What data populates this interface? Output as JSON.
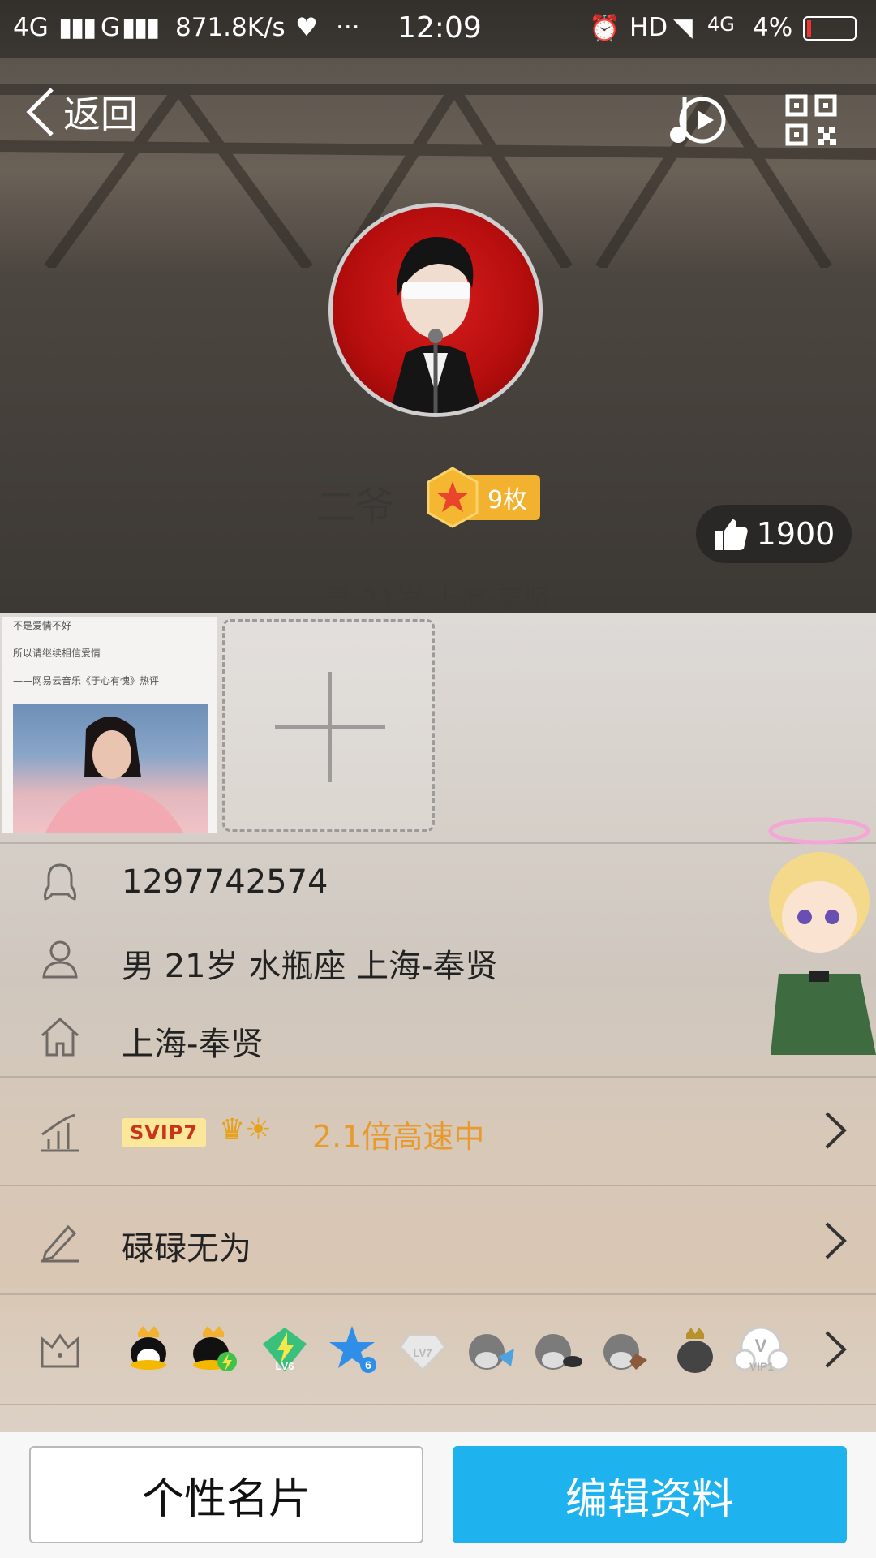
{
  "status_bar": {
    "network1": "4G",
    "network2": "G",
    "speed": "871.8K/s",
    "more": "···",
    "time": "12:09",
    "hd": "HD",
    "net3": "4G",
    "battery": "4%"
  },
  "header": {
    "back_label": "返回",
    "music_icon": "music-play-icon",
    "qr_icon": "qr-code-icon"
  },
  "profile": {
    "name": "二爷",
    "medal_count": "9枚",
    "likes": "1900",
    "subline": "男  21岁  上海 奉贤"
  },
  "photos": {
    "photo1_lines": [
      "不是爱情不好",
      "所以请继续相信爱情",
      "——网易云音乐《于心有愧》热评"
    ]
  },
  "info": {
    "qq_number": "1297742574",
    "personal": "男  21岁  水瓶座  上海-奉贤",
    "hometown": "上海-奉贤",
    "svip_label": "SVIP7",
    "speed_text": "2.1倍高速中",
    "signature": "碌碌无为",
    "vip_label": "VIP1"
  },
  "buttons": {
    "card": "个性名片",
    "edit": "编辑资料"
  },
  "colors": {
    "accent": "#1eb3ef",
    "speed": "#e89b2c",
    "medal": "#f2b12e"
  }
}
